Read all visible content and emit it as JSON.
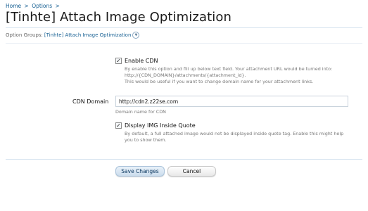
{
  "breadcrumb": {
    "items": [
      "Home",
      "Options"
    ],
    "separator": ">"
  },
  "page_title": "[Tinhte] Attach Image Optimization",
  "option_groups": {
    "label": "Option Groups:",
    "value": "[Tinhte] Attach Image Optimization",
    "icon": "chevron-down-icon"
  },
  "options": {
    "enable_cdn": {
      "label": "Enable CDN",
      "checked": true,
      "explain": [
        "By enable this option and fill up below text field. Your attachment URL would be turned into:",
        "http://{CDN_DOMAIN}/attachments/{attachment_id}.",
        "This would be useful if you want to change domain name for your attachment links."
      ]
    },
    "cdn_domain": {
      "label": "CDN Domain",
      "value": "http://cdn2.z22se.com",
      "explain": "Domain name for CDN"
    },
    "display_img_inside_quote": {
      "label": "Display IMG Inside Quote",
      "checked": true,
      "explain": [
        "By default, a full attached image would not be displayed inside quote tag. Enable this might help",
        "you to show them."
      ]
    }
  },
  "buttons": {
    "save": "Save Changes",
    "cancel": "Cancel"
  },
  "colors": {
    "link": "#176093",
    "title": "#1a1a1a",
    "muted": "#777777",
    "rule": "#d7e4ef"
  }
}
